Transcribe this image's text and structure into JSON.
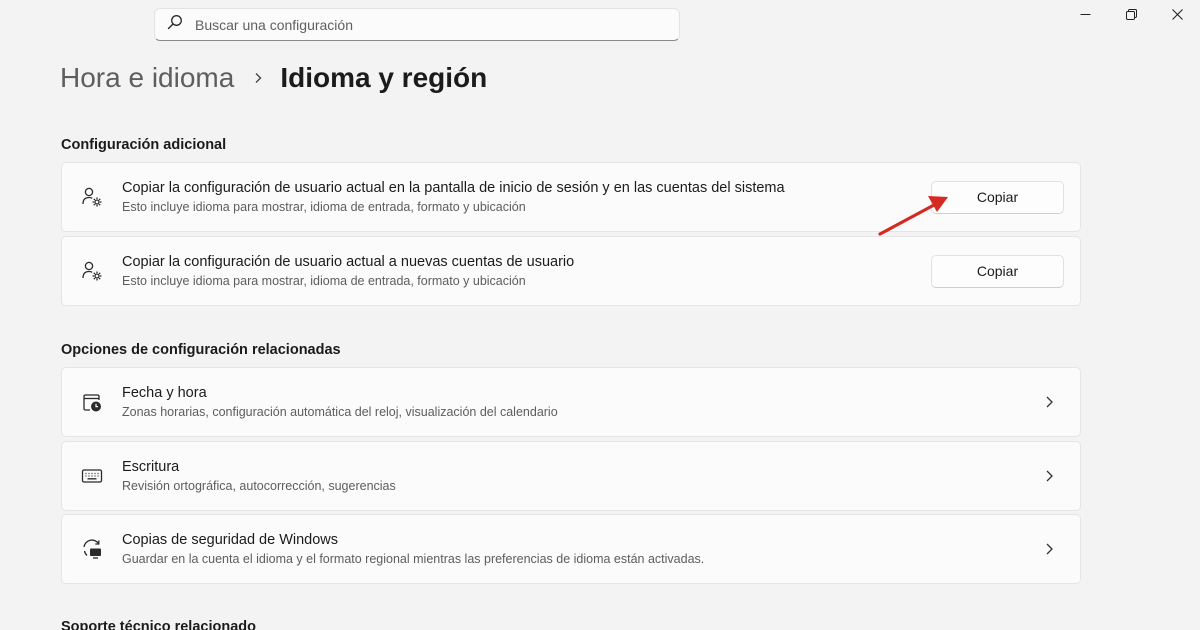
{
  "search": {
    "placeholder": "Buscar una configuración"
  },
  "breadcrumb": {
    "parent": "Hora e idioma",
    "current": "Idioma y región"
  },
  "sections": {
    "additional": {
      "title": "Configuración adicional",
      "items": [
        {
          "title": "Copiar la configuración de usuario actual en la pantalla de inicio de sesión y en las cuentas del sistema",
          "subtitle": "Esto incluye idioma para mostrar, idioma de entrada, formato y ubicación",
          "button": "Copiar",
          "icon": "user-settings-icon"
        },
        {
          "title": "Copiar la configuración de usuario actual a nuevas cuentas de usuario",
          "subtitle": "Esto incluye idioma para mostrar, idioma de entrada, formato y ubicación",
          "button": "Copiar",
          "icon": "user-settings-icon"
        }
      ]
    },
    "related": {
      "title": "Opciones de configuración relacionadas",
      "items": [
        {
          "title": "Fecha y hora",
          "subtitle": "Zonas horarias, configuración automática del reloj, visualización del calendario",
          "icon": "calendar-clock-icon"
        },
        {
          "title": "Escritura",
          "subtitle": "Revisión ortográfica, autocorrección, sugerencias",
          "icon": "keyboard-icon"
        },
        {
          "title": "Copias de seguridad de Windows",
          "subtitle": "Guardar en la cuenta el idioma y el formato regional mientras las preferencias de idioma están activadas.",
          "icon": "backup-sync-icon"
        }
      ]
    },
    "support": {
      "title": "Soporte técnico relacionado"
    }
  },
  "colors": {
    "annotation_arrow": "#d42a22",
    "background": "#f3f3f3",
    "card": "#fbfbfb"
  }
}
